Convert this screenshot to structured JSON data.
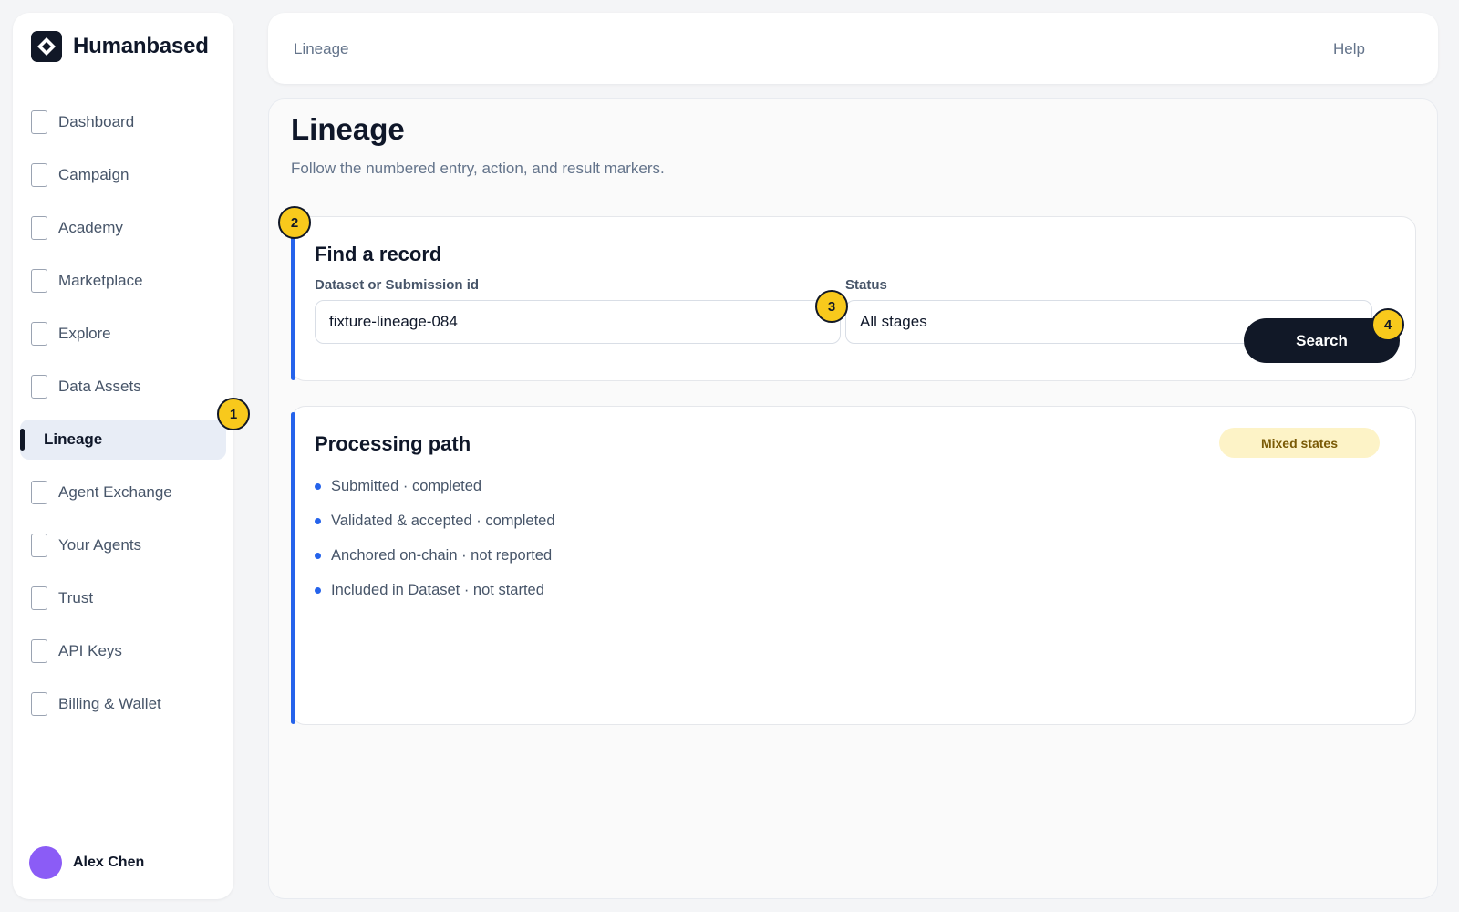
{
  "brand": {
    "name": "Humanbased"
  },
  "sidebar": {
    "items": [
      {
        "label": "Dashboard"
      },
      {
        "label": "Campaign"
      },
      {
        "label": "Academy"
      },
      {
        "label": "Marketplace"
      },
      {
        "label": "Explore"
      },
      {
        "label": "Data Assets"
      },
      {
        "label": "Lineage",
        "active": true
      },
      {
        "label": "Agent Exchange"
      },
      {
        "label": "Your Agents"
      },
      {
        "label": "Trust"
      },
      {
        "label": "API Keys"
      },
      {
        "label": "Billing & Wallet"
      }
    ],
    "user": {
      "name": "Alex Chen",
      "avatar_color": "#8b5cf6"
    }
  },
  "topbar": {
    "breadcrumb": "Lineage",
    "help": "Help"
  },
  "page": {
    "title": "Lineage",
    "subtitle": "Follow the numbered entry, action, and result markers."
  },
  "find": {
    "title": "Find a record",
    "id_label": "Dataset or Submission id",
    "id_value": "fixture-lineage-084",
    "status_label": "Status",
    "status_value": "All stages",
    "search_label": "Search"
  },
  "path": {
    "title": "Processing path",
    "badge": "Mixed states",
    "steps": [
      {
        "text": "Submitted · completed"
      },
      {
        "text": "Validated & accepted · completed"
      },
      {
        "text": "Anchored on-chain · not reported"
      },
      {
        "text": "Included in Dataset · not started"
      }
    ]
  },
  "markers": [
    "1",
    "2",
    "3",
    "4"
  ],
  "colors": {
    "accent": "#2563eb",
    "marker": "#f8c91c",
    "badge_bg": "#fdf3c7",
    "dark": "#111827"
  }
}
